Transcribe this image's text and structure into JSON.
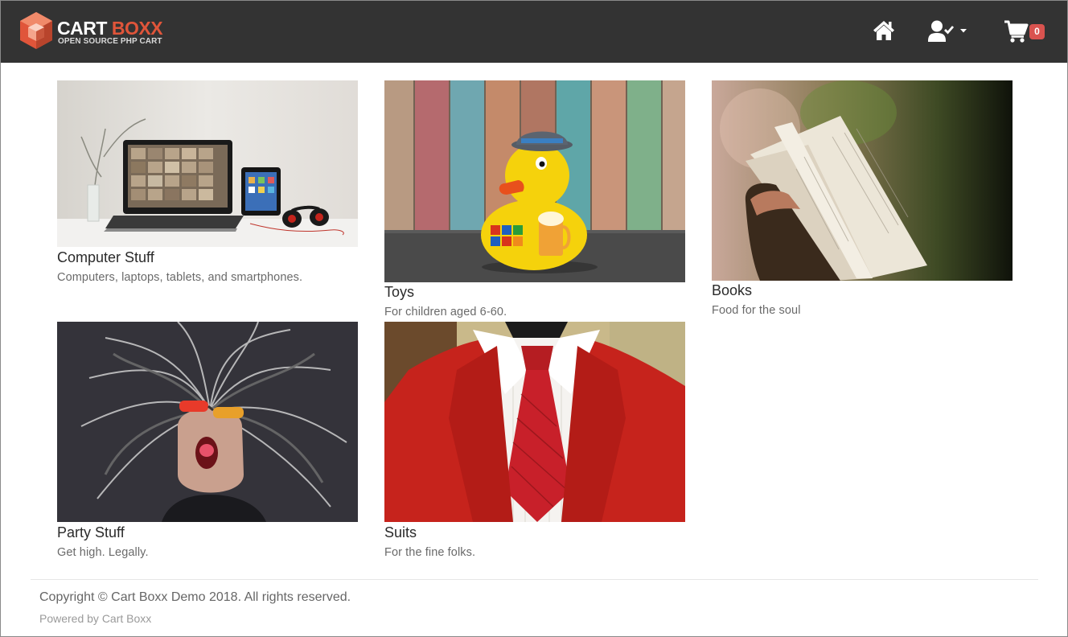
{
  "brand": {
    "title_part1": "CART",
    "title_part2": "BOXX",
    "subtitle": "OPEN SOURCE PHP CART"
  },
  "nav": {
    "home_icon": "home-icon",
    "user_icon": "user-check-icon",
    "cart_icon": "shopping-cart-icon",
    "cart_count": "0"
  },
  "categories": [
    {
      "title": "Computer Stuff",
      "description": "Computers, laptops, tablets, and smartphones."
    },
    {
      "title": "Toys",
      "description": "For children aged 6-60."
    },
    {
      "title": "Books",
      "description": "Food for the soul"
    },
    {
      "title": "Party Stuff",
      "description": "Get high. Legally."
    },
    {
      "title": "Suits",
      "description": "For the fine folks."
    }
  ],
  "footer": {
    "copyright": "Copyright © Cart Boxx Demo 2018. All rights reserved.",
    "powered": "Powered by Cart Boxx"
  },
  "colors": {
    "navbar_bg": "#333333",
    "brand_accent": "#e0553a",
    "badge_bg": "#d9534f"
  }
}
